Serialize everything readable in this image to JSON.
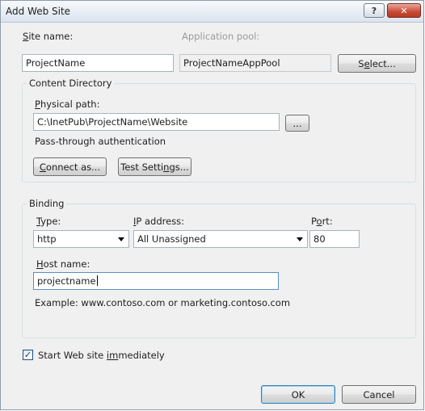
{
  "window": {
    "title": "Add Web Site",
    "help_label": "?",
    "close_label": "✕"
  },
  "site": {
    "name_label_key": "S",
    "name_label_rest": "ite name:",
    "name_value": "ProjectName",
    "pool_label": "Application pool:",
    "pool_value": "ProjectNameAppPool",
    "select_pre": "S",
    "select_key": "e",
    "select_post": "lect..."
  },
  "content": {
    "group_title": "Content Directory",
    "path_label_key": "P",
    "path_label_rest": "hysical path:",
    "path_value": "C:\\InetPub\\ProjectName\\Website",
    "browse_label": "...",
    "passthrough_text": "Pass-through authentication",
    "connect_key": "C",
    "connect_rest": "onnect as...",
    "test_pre": "Test Setti",
    "test_key": "n",
    "test_post": "gs..."
  },
  "binding": {
    "group_title": "Binding",
    "type_label_key": "T",
    "type_label_rest": "ype:",
    "type_value": "http",
    "ip_label_key": "I",
    "ip_label_rest": "P address:",
    "ip_value": "All Unassigned",
    "port_label_pre": "P",
    "port_label_key": "o",
    "port_label_post": "rt:",
    "port_value": "80",
    "host_label_key": "H",
    "host_label_rest": "ost name:",
    "host_value": "projectname",
    "example_text": "Example: www.contoso.com or marketing.contoso.com"
  },
  "start": {
    "checked": true,
    "check_glyph": "✓",
    "label_pre": "Start Web site ",
    "label_key": "im",
    "label_post": "mediately"
  },
  "footer": {
    "ok_label": "OK",
    "cancel_label": "Cancel"
  }
}
